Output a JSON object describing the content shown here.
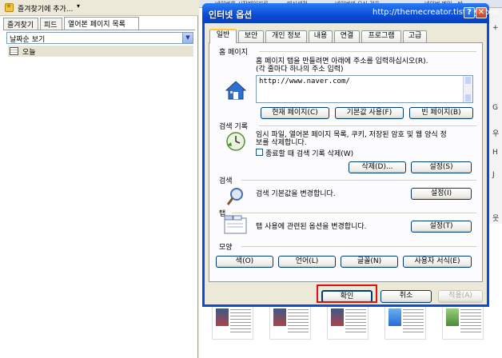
{
  "left_panel": {
    "title": "즐겨찾기에 추가...",
    "tabs": [
      "즐겨찾기",
      "피드",
      "열어본 페이지 목록"
    ],
    "view_select": "날짜순 보기",
    "history_items": [
      "오늘"
    ]
  },
  "background": {
    "tab_texts": [
      "네이버를 시작페이지로",
      "매신생전",
      "네이버에 오신 것을",
      "네이버 메일 - 반"
    ],
    "strip_chars": [
      "+",
      "G",
      "우",
      "H",
      "J",
      "웃"
    ]
  },
  "dialog": {
    "title": "인터넷 옵션",
    "watermark": "http://themecreator.tistory.com",
    "help_glyph": "?",
    "close_glyph": "✕",
    "tabs": [
      "일반",
      "보안",
      "개인 정보",
      "내용",
      "연결",
      "프로그램",
      "고급"
    ],
    "home": {
      "label": "홈 페이지",
      "desc_line1": "홈 페이지 탭을 만들려면 아래에 주소를 입력하십시오(R).",
      "desc_line2": "(각 줄마다 하나의 주소 입력)",
      "url": "http://www.naver.com/",
      "btn_current": "현재 페이지(C)",
      "btn_default": "기본값 사용(F)",
      "btn_blank": "빈 페이지(B)"
    },
    "history": {
      "label": "검색 기록",
      "desc_line1": "임시 파일, 열어본 페이지 목록, 쿠키, 저장된 암호 및 웹 양식 정",
      "desc_line2": "보를 삭제합니다.",
      "checkbox_label": "종료할 때 검색 기록 삭제(W)",
      "checkbox_checked": false,
      "btn_delete": "삭제(D)...",
      "btn_settings": "설정(S)"
    },
    "search": {
      "label": "검색",
      "desc": "검색 기본값을 변경합니다.",
      "btn_settings": "설정(I)"
    },
    "tabs_section": {
      "label": "탭",
      "desc": "탭 사용에 관련된 옵션을 변경합니다.",
      "btn_settings": "설정(T)"
    },
    "appearance": {
      "label": "모양",
      "btn_colors": "색(O)",
      "btn_languages": "언어(L)",
      "btn_fonts": "글꼴(N)",
      "btn_accessibility": "사용자 서식(E)"
    },
    "footer": {
      "ok": "확인",
      "cancel": "취소",
      "apply": "적용(A)"
    }
  },
  "colors": {
    "titlebar": "#0a4cd6",
    "highlight": "#e01010"
  }
}
